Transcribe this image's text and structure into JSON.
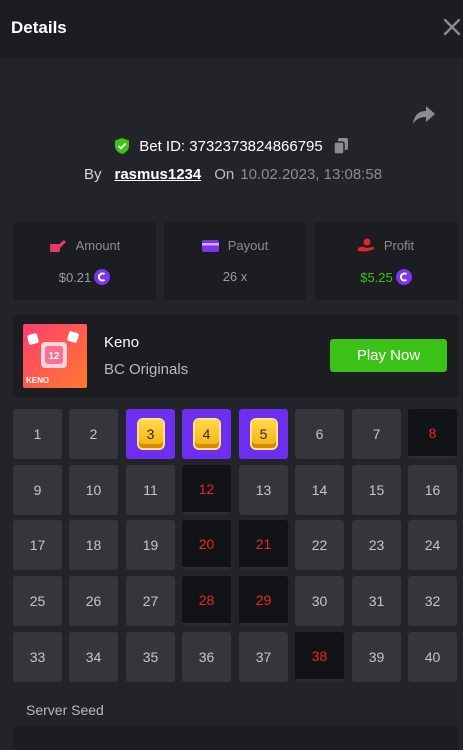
{
  "header": {
    "title": "Details"
  },
  "bet": {
    "id_text": "Bet ID: 3732373824866795",
    "by_label": "By",
    "username": "rasmus1234",
    "on_label": "On",
    "date": "10.02.2023, 13:08:58"
  },
  "stats": {
    "amount": {
      "label": "Amount",
      "value": "$0.21"
    },
    "payout": {
      "label": "Payout",
      "value": "26 x"
    },
    "profit": {
      "label": "Profit",
      "value": "$5.25"
    }
  },
  "game": {
    "name": "Keno",
    "provider": "BC Originals",
    "play_label": "Play Now",
    "thumb_number": "12",
    "thumb_label": "KENO"
  },
  "board": {
    "numbers": [
      1,
      2,
      3,
      4,
      5,
      6,
      7,
      8,
      9,
      10,
      11,
      12,
      13,
      14,
      15,
      16,
      17,
      18,
      19,
      20,
      21,
      22,
      23,
      24,
      25,
      26,
      27,
      28,
      29,
      30,
      31,
      32,
      33,
      34,
      35,
      36,
      37,
      38,
      39,
      40
    ],
    "hits": [
      3,
      4,
      5
    ],
    "picked": [
      8,
      12,
      20,
      21,
      28,
      29,
      38
    ]
  },
  "server_seed": {
    "label": "Server Seed"
  },
  "colors": {
    "background": "#232429",
    "panel": "#1c1d21",
    "cell": "#35363c",
    "hit": "#6e2ef0",
    "picked_text": "#e5262b",
    "play_button": "#3bc117",
    "profit_text": "#3bc117"
  },
  "icons": {
    "close": "close-icon",
    "share": "share-icon",
    "verified": "shield-check-icon",
    "copy": "copy-icon",
    "amount": "bet-chip-icon",
    "payout": "card-icon",
    "profit": "hand-coin-icon",
    "currency": "coin-icon"
  }
}
